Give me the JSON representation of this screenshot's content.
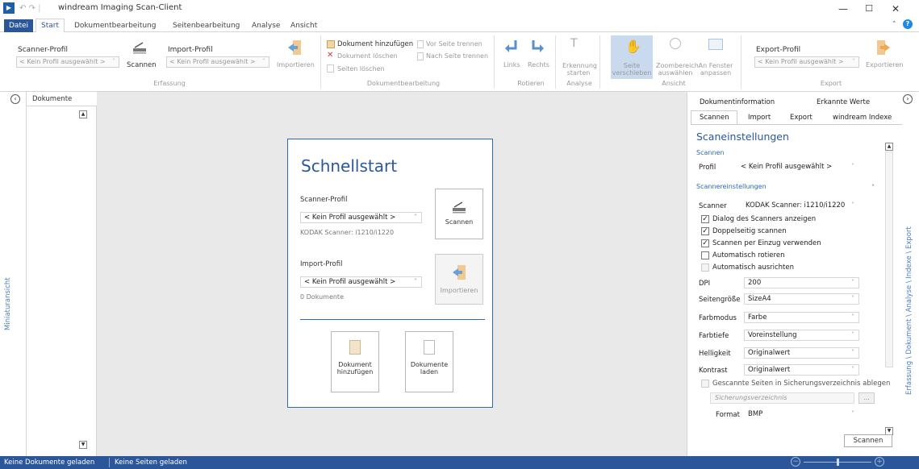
{
  "window": {
    "title": "windream Imaging Scan-Client",
    "minimize": "—",
    "maximize": "☐",
    "close": "✕"
  },
  "ribbon_tabs": [
    {
      "label": "Datei"
    },
    {
      "label": "Start"
    },
    {
      "label": "Dokumentbearbeitung"
    },
    {
      "label": "Seitenbearbeitung"
    },
    {
      "label": "Analyse"
    },
    {
      "label": "Ansicht"
    }
  ],
  "ribbon": {
    "scanner_profile_label": "Scanner-Profil",
    "scanner_profile_value": "< Kein Profil ausgewählt >",
    "scan_button": "Scannen",
    "import_profile_label": "Import-Profil",
    "import_profile_value": "< Kein Profil ausgewählt >",
    "import_button": "Importieren",
    "group_erfassung": "Erfassung",
    "doc_add": "Dokument hinzufügen",
    "doc_delete": "Dokument löschen",
    "pages_delete": "Seiten löschen",
    "split_before": "Vor Seite trennen",
    "split_after": "Nach Seite trennen",
    "group_dokumentbearbeitung": "Dokumentbearbeitung",
    "rotate_left": "Links",
    "rotate_right": "Rechts",
    "group_rotieren": "Rotieren",
    "recognition_line1": "Erkennung",
    "recognition_line2": "starten",
    "group_analyse": "Analyse",
    "page_move_line1": "Seite",
    "page_move_line2": "verschieben",
    "zoom_line1": "Zoombereich",
    "zoom_line2": "auswählen",
    "fit_line1": "An Fenster",
    "fit_line2": "anpassen",
    "group_ansicht": "Ansicht",
    "export_profile_label": "Export-Profil",
    "export_profile_value": "< Kein Profil ausgewählt >",
    "export_button": "Exportieren",
    "group_export": "Export"
  },
  "left_panel": {
    "tab": "Dokumente",
    "vertical_label": "Miniaturansicht"
  },
  "quickstart": {
    "title": "Schnellstart",
    "scanner_profile_label": "Scanner-Profil",
    "scanner_profile_value": "< Kein Profil ausgewählt >",
    "scanner_name": "KODAK Scanner: i1210/i1220",
    "scan_button": "Scannen",
    "import_profile_label": "Import-Profil",
    "import_profile_value": "< Kein Profil ausgewählt >",
    "import_count": "0 Dokumente",
    "import_button": "Importieren",
    "add_doc_line1": "Dokument",
    "add_doc_line2": "hinzufügen",
    "load_doc_line1": "Dokumente",
    "load_doc_line2": "laden"
  },
  "right_panel": {
    "top_tabs": [
      "Dokumentinformation",
      "Erkannte Werte"
    ],
    "sub_tabs": [
      "Scannen",
      "Import",
      "Export",
      "windream Indexe"
    ],
    "heading": "Scaneinstellungen",
    "section_scan": "Scannen",
    "profile_label": "Profil",
    "profile_value": "< Kein Profil ausgewählt >",
    "section_scanner_settings": "Scannereinstellungen",
    "scanner_label": "Scanner",
    "scanner_value": "KODAK Scanner: i1210/i1220",
    "checkboxes": [
      {
        "label": "Dialog des Scanners anzeigen",
        "checked": "✓"
      },
      {
        "label": "Doppelseitig scannen",
        "checked": "✓"
      },
      {
        "label": "Scannen per Einzug verwenden",
        "checked": "✓"
      },
      {
        "label": "Automatisch rotieren",
        "checked": ""
      },
      {
        "label": "Automatisch ausrichten",
        "checked": ""
      }
    ],
    "fields": [
      {
        "label": "DPI",
        "value": "200"
      },
      {
        "label": "Seitengröße",
        "value": "SizeA4"
      },
      {
        "label": "Farbmodus",
        "value": "Farbe"
      },
      {
        "label": "Farbtiefe",
        "value": "Voreinstellung"
      },
      {
        "label": "Helligkeit",
        "value": "Originalwert"
      },
      {
        "label": "Kontrast",
        "value": "Originalwert"
      }
    ],
    "backup_checkbox": "Gescannte Seiten in Sicherungsverzeichnis ablegen",
    "backup_placeholder": "Sicherungsverzeichnis",
    "browse_button": "...",
    "format_label": "Format",
    "format_value": "BMP",
    "scan_button": "Scannen",
    "vertical_label": "Erfassung \\ Dokument \\ Analyse \\ Indexe \\ Export"
  },
  "status": {
    "docs": "Keine Dokumente geladen",
    "pages": "Keine Seiten geladen"
  },
  "colors": {
    "accent": "#2b579a",
    "card_border": "#2b6ab5"
  }
}
